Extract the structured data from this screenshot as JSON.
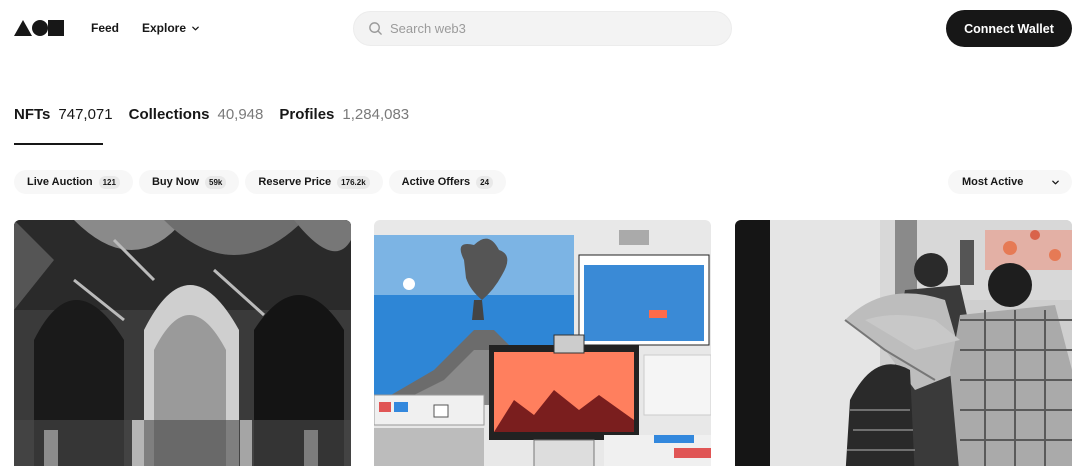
{
  "header": {
    "logo_icon": "shapes-logo-icon",
    "nav": {
      "feed": "Feed",
      "explore": "Explore"
    },
    "search": {
      "placeholder": "Search web3",
      "icon": "search-icon"
    },
    "connect_wallet": "Connect Wallet"
  },
  "tabs": [
    {
      "label": "NFTs",
      "count": "747,071",
      "active": true
    },
    {
      "label": "Collections",
      "count": "40,948",
      "active": false
    },
    {
      "label": "Profiles",
      "count": "1,284,083",
      "active": false
    }
  ],
  "filters": [
    {
      "label": "Live Auction",
      "count": "121"
    },
    {
      "label": "Buy Now",
      "count": "59k"
    },
    {
      "label": "Reserve Price",
      "count": "176.2k"
    },
    {
      "label": "Active Offers",
      "count": "24"
    }
  ],
  "sort": {
    "label": "Most Active",
    "icon": "chevron-down-icon"
  },
  "cards": [
    {
      "image": "mosque-arches-artwork"
    },
    {
      "image": "volcano-collage-artwork"
    },
    {
      "image": "street-photo-artwork"
    }
  ],
  "colors": {
    "primary": "#171717",
    "muted": "#7a7a7a",
    "pill_bg": "#f7f7f7"
  }
}
